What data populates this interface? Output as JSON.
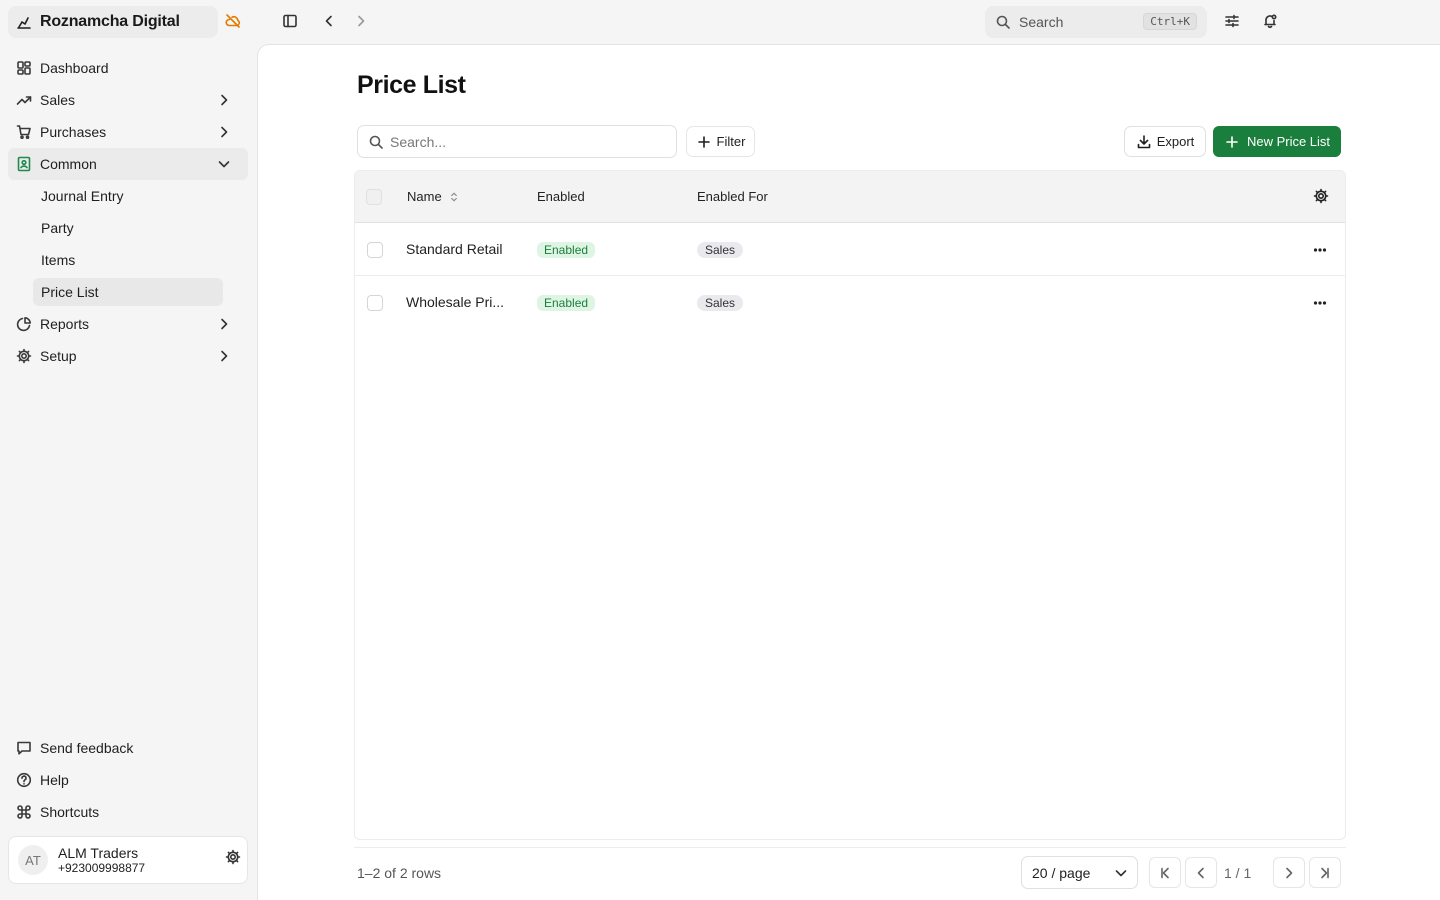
{
  "app": {
    "name": "Roznamcha Digital",
    "brand_icon": "chart-app-icon",
    "sync_status_icon": "cloud-off-icon",
    "sync_status_color": "#e07b00"
  },
  "topbar": {
    "search_label": "Search",
    "search_shortcut": "Ctrl+K"
  },
  "sidebar": {
    "items": [
      {
        "label": "Dashboard",
        "icon": "dashboard-icon"
      },
      {
        "label": "Sales",
        "icon": "trending-up-icon",
        "expandable": true
      },
      {
        "label": "Purchases",
        "icon": "cart-icon",
        "expandable": true
      },
      {
        "label": "Common",
        "icon": "book-icon",
        "expanded": true
      },
      {
        "label": "Reports",
        "icon": "pie-chart-icon",
        "expandable": true
      },
      {
        "label": "Setup",
        "icon": "gear-icon",
        "expandable": true
      }
    ],
    "common_children": [
      "Journal Entry",
      "Party",
      "Items",
      "Price List"
    ],
    "active_child": "Price List",
    "footer": [
      {
        "label": "Send feedback",
        "icon": "message-icon"
      },
      {
        "label": "Help",
        "icon": "help-icon"
      },
      {
        "label": "Shortcuts",
        "icon": "command-icon"
      }
    ],
    "user": {
      "initials": "AT",
      "name": "ALM Traders",
      "phone": "+923009998877"
    }
  },
  "page": {
    "title": "Price List",
    "search_placeholder": "Search...",
    "filter_label": "Filter",
    "export_label": "Export",
    "new_label": "New Price List",
    "accent_color": "#1a7f3c"
  },
  "table": {
    "columns": [
      "Name",
      "Enabled",
      "Enabled For"
    ],
    "rows": [
      {
        "name": "Standard Retail",
        "enabled": "Enabled",
        "enabled_for": "Sales"
      },
      {
        "name": "Wholesale Pri...",
        "enabled": "Enabled",
        "enabled_for": "Sales"
      }
    ]
  },
  "pagination": {
    "row_count": "1–2 of 2 rows",
    "page_size": "20 / page",
    "indicator": "1 / 1"
  }
}
